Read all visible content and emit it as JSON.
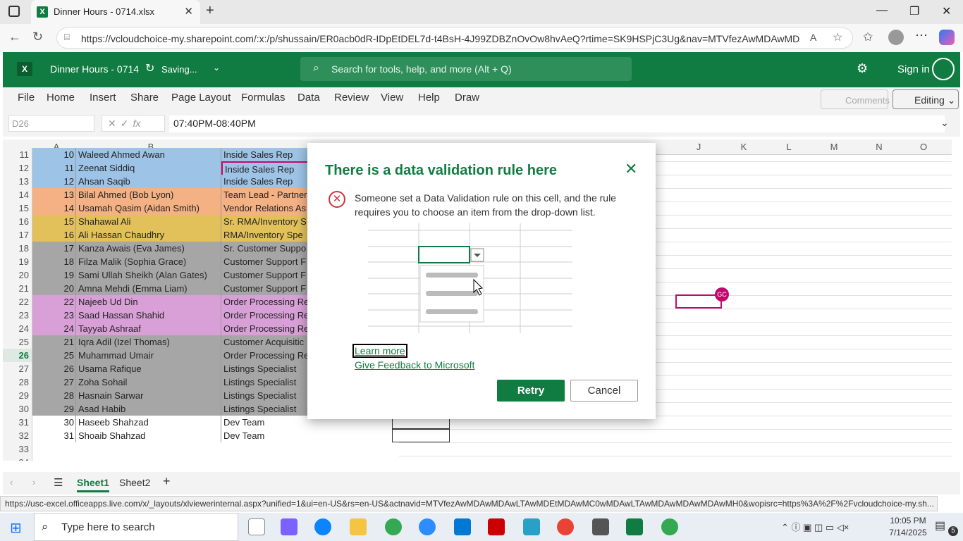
{
  "browser": {
    "tab_title": "Dinner Hours - 0714.xlsx",
    "url": "https://vcloudchoice-my.sharepoint.com/:x:/p/shussain/ER0acb0dR-IDpEtDEL7d-t4BsH-4J99ZDBZnOvOw8hvAeQ?rtime=SK9HSPjC3Ug&nav=MTVfezAwMDAwMDA..."
  },
  "excel": {
    "doc_name": "Dinner Hours - 0714",
    "saving": "Saving...",
    "search_placeholder": "Search for tools, help, and more (Alt + Q)",
    "sign_in": "Sign in",
    "ribbon_tabs": [
      "File",
      "Home",
      "Insert",
      "Share",
      "Page Layout",
      "Formulas",
      "Data",
      "Review",
      "View",
      "Help",
      "Draw"
    ],
    "comments": "Comments",
    "editing": "Editing",
    "name_box": "D26",
    "fx": "fx",
    "formula": "07:40PM-08:40PM",
    "columns": [
      "A",
      "B",
      "",
      "",
      "",
      "",
      "",
      "",
      "",
      "J",
      "K",
      "L",
      "M",
      "N",
      "O"
    ],
    "rows": [
      {
        "r": "11",
        "a": "10",
        "b": "Waleed Ahmed Awan",
        "c": "Inside Sales Rep",
        "color": "#9dc3e6"
      },
      {
        "r": "12",
        "a": "11",
        "b": "Zeenat Siddiq",
        "c": "Inside Sales Rep",
        "color": "#9dc3e6"
      },
      {
        "r": "13",
        "a": "12",
        "b": "Ahsan Saqib",
        "c": "Inside Sales Rep",
        "color": "#9dc3e6"
      },
      {
        "r": "14",
        "a": "13",
        "b": "Bilal Ahmed (Bob Lyon)",
        "c": "Team Lead - Partner",
        "color": "#f4b183"
      },
      {
        "r": "15",
        "a": "14",
        "b": "Usamah Qasim (Aidan Smith)",
        "c": "Vendor Relations As",
        "color": "#f4b183"
      },
      {
        "r": "16",
        "a": "15",
        "b": "Shahawal Ali",
        "c": "Sr. RMA/Inventory S",
        "color": "#e2c05a"
      },
      {
        "r": "17",
        "a": "16",
        "b": "Ali Hassan Chaudhry",
        "c": "RMA/Inventory Spe",
        "color": "#e2c05a"
      },
      {
        "r": "18",
        "a": "17",
        "b": "Kanza Awais (Eva James)",
        "c": "Sr. Customer Suppo",
        "color": "#a6a6a6"
      },
      {
        "r": "19",
        "a": "18",
        "b": "Filza Malik (Sophia Grace)",
        "c": "Customer Support F",
        "color": "#a6a6a6"
      },
      {
        "r": "20",
        "a": "19",
        "b": "Sami Ullah Sheikh (Alan Gates)",
        "c": "Customer Support F",
        "color": "#a6a6a6"
      },
      {
        "r": "21",
        "a": "20",
        "b": "Amna Mehdi (Emma Liam)",
        "c": "Customer Support F",
        "color": "#a6a6a6"
      },
      {
        "r": "22",
        "a": "22",
        "b": "Najeeb Ud Din",
        "c": "Order Processing Re",
        "color": "#d9a0d8"
      },
      {
        "r": "23",
        "a": "23",
        "b": "Saad Hassan Shahid",
        "c": "Order Processing Re",
        "color": "#d9a0d8"
      },
      {
        "r": "24",
        "a": "24",
        "b": "Tayyab Ashraaf",
        "c": "Order Processing Re",
        "color": "#d9a0d8"
      },
      {
        "r": "25",
        "a": "21",
        "b": "Iqra Adil (Izel Thomas)",
        "c": "Customer Acquisitic",
        "color": "#a6a6a6"
      },
      {
        "r": "26",
        "a": "25",
        "b": "Muhammad Umair",
        "c": "Order Processing Re",
        "color": "#a6a6a6"
      },
      {
        "r": "27",
        "a": "26",
        "b": "Usama Rafique",
        "c": "Listings Specialist",
        "color": "#a6a6a6"
      },
      {
        "r": "28",
        "a": "27",
        "b": "Zoha Sohail",
        "c": "Listings Specialist",
        "color": "#a6a6a6"
      },
      {
        "r": "29",
        "a": "28",
        "b": "Hasnain Sarwar",
        "c": "Listings Specialist",
        "color": "#a6a6a6"
      },
      {
        "r": "30",
        "a": "29",
        "b": "Asad Habib",
        "c": "Listings Specialist",
        "color": "#a6a6a6"
      },
      {
        "r": "31",
        "a": "30",
        "b": "Haseeb Shahzad",
        "c": "Dev Team",
        "color": "#ffffff"
      },
      {
        "r": "32",
        "a": "31",
        "b": "Shoaib Shahzad",
        "c": "Dev Team",
        "color": "#ffffff"
      },
      {
        "r": "33",
        "a": "",
        "b": "",
        "c": "",
        "color": "#ffffff"
      },
      {
        "r": "34",
        "a": "",
        "b": "",
        "c": "",
        "color": "#ffffff"
      }
    ],
    "presence_badge": "GC",
    "sheets": [
      "Sheet1",
      "Sheet2"
    ]
  },
  "dialog": {
    "title": "There is a data validation rule here",
    "message": "Someone set a Data Validation rule on this cell, and the rule requires you to choose an item from the drop-down list.",
    "learn_more": "Learn more",
    "feedback": "Give Feedback to Microsoft",
    "retry": "Retry",
    "cancel": "Cancel"
  },
  "status_url": "https://usc-excel.officeapps.live.com/x/_layouts/xlviewerinternal.aspx?unified=1&ui=en-US&rs=en-US&actnavid=MTVfezAwMDAwMDAwLTAwMDEtMDAwMC0wMDAwLTAwMDAwMDAwMDAwMH0&wopisrc=https%3A%2F%2Fvcloudchoice-my.sh...",
  "taskbar": {
    "search_placeholder": "Type here to search",
    "time": "10:05 PM",
    "date": "7/14/2025",
    "notifications": "5"
  },
  "colors": {
    "excel_green": "#107c41",
    "error_red": "#d13438",
    "selection_magenta": "#c00a6e"
  }
}
